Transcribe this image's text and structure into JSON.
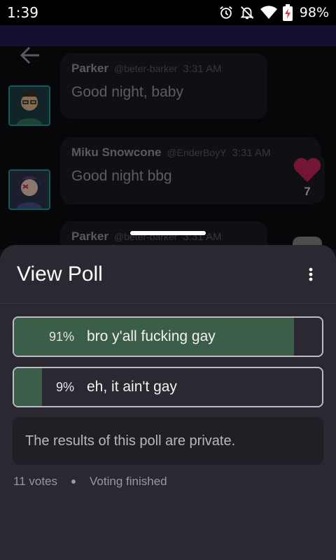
{
  "status_bar": {
    "time": "1:39",
    "battery": "98%",
    "icons": [
      "alarm-icon",
      "notifications-off-icon",
      "wifi-icon",
      "battery-charging-icon"
    ]
  },
  "chat": {
    "messages": [
      {
        "name": "Parker",
        "handle": "@beter-barker",
        "time": "3:31 AM",
        "text": "Good night, baby"
      },
      {
        "name": "Miku Snowcone",
        "handle": "@EnderBoyY",
        "time": "3:31 AM",
        "text": "Good night bbg",
        "reaction_count": "7"
      },
      {
        "name": "Parker",
        "handle": "@beter-barker",
        "time": "3:31 AM",
        "text": ""
      }
    ]
  },
  "poll": {
    "title": "View Poll",
    "options": [
      {
        "percent": "91%",
        "label": "bro y'all fucking gay",
        "fraction": 0.91
      },
      {
        "percent": "9%",
        "label": "eh, it ain't gay",
        "fraction": 0.09
      }
    ],
    "private_notice": "The results of this poll are private.",
    "votes": "11 votes",
    "status": "Voting finished"
  },
  "colors": {
    "sheet_bg": "#2c2831",
    "poll_fill": "#3a5e48",
    "reaction_heart": "#b0234f",
    "avatar_border": "#1c8a8a"
  }
}
